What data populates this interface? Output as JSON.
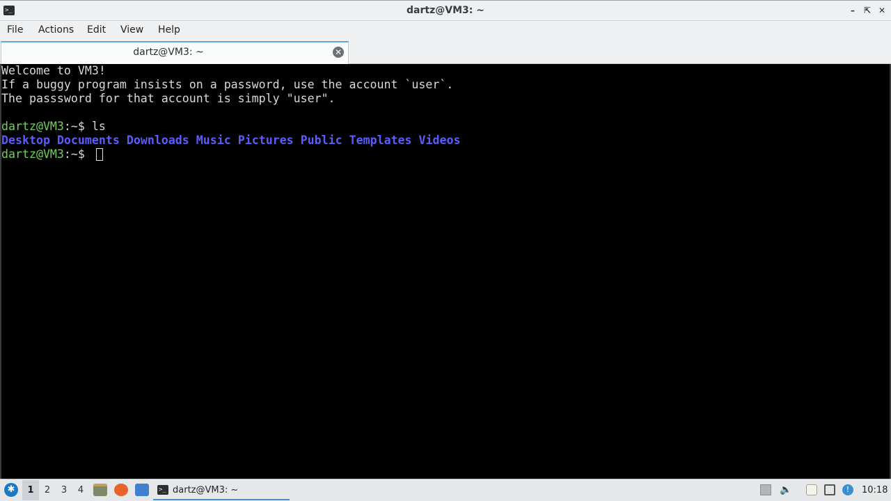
{
  "window": {
    "title": "dartz@VM3: ~",
    "icon": "terminal-icon"
  },
  "menu": [
    "File",
    "Actions",
    "Edit",
    "View",
    "Help"
  ],
  "tab": {
    "title": "dartz@VM3: ~",
    "close_icon": "close-tab-icon"
  },
  "terminal": {
    "lines": [
      "Welcome to VM3!",
      "If a buggy program insists on a password, use the account `user`.",
      "The passsword for that account is simply \"user\"."
    ],
    "prompt_user_host": "dartz@VM3",
    "prompt_path": ":~$ ",
    "command": "ls",
    "ls_output": [
      "Desktop",
      "Documents",
      "Downloads",
      "Music",
      "Pictures",
      "Public",
      "Templates",
      "Videos"
    ],
    "dir_color": "#5c5cff",
    "prompt_color": "#6fd25a"
  },
  "taskbar": {
    "workspaces": [
      "1",
      "2",
      "3",
      "4"
    ],
    "active_workspace": "1",
    "task_label": "dartz@VM3: ~",
    "clock": "10:18"
  }
}
